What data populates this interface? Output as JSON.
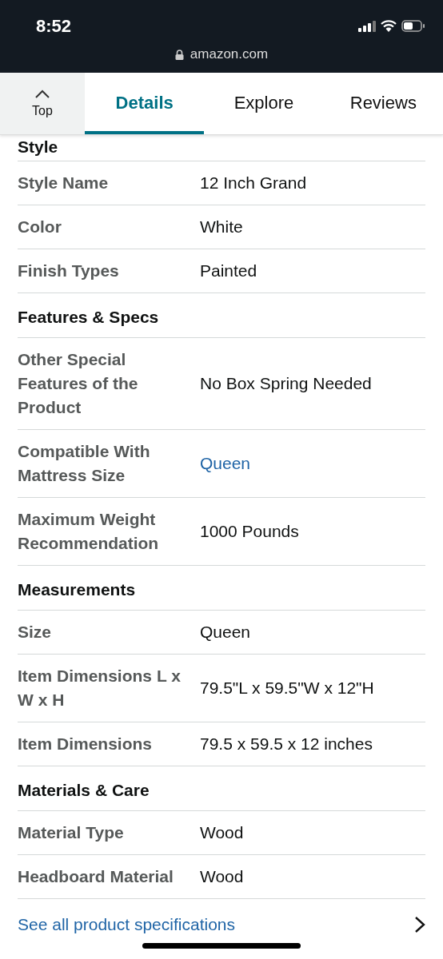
{
  "status_bar": {
    "time": "8:52",
    "url": "amazon.com"
  },
  "tabs": [
    {
      "label": "Top",
      "kind": "top",
      "selected": false
    },
    {
      "label": "Details",
      "kind": "tab",
      "selected": true
    },
    {
      "label": "Explore",
      "kind": "tab",
      "selected": false
    },
    {
      "label": "Reviews",
      "kind": "tab",
      "selected": false
    }
  ],
  "sections": [
    {
      "title": "Style",
      "rows": [
        {
          "label": "Style Name",
          "value": "12 Inch Grand",
          "kind": "text"
        },
        {
          "label": "Color",
          "value": "White",
          "kind": "text"
        },
        {
          "label": "Finish Types",
          "value": "Painted",
          "kind": "text"
        }
      ]
    },
    {
      "title": "Features & Specs",
      "rows": [
        {
          "label": "Other Special Features of the Product",
          "value": "No Box Spring Needed",
          "kind": "text"
        },
        {
          "label": "Compatible With Mattress Size",
          "value": "Queen",
          "kind": "link"
        },
        {
          "label": "Maximum Weight Recommendation",
          "value": "1000 Pounds",
          "kind": "text"
        }
      ]
    },
    {
      "title": "Measurements",
      "rows": [
        {
          "label": "Size",
          "value": "Queen",
          "kind": "text"
        },
        {
          "label": "Item Dimensions L x W x H",
          "value": "79.5\"L x 59.5\"W x 12\"H",
          "kind": "text"
        },
        {
          "label": "Item Dimensions",
          "value": "79.5 x 59.5 x 12 inches",
          "kind": "text"
        }
      ]
    },
    {
      "title": "Materials & Care",
      "rows": [
        {
          "label": "Material Type",
          "value": "Wood",
          "kind": "text"
        },
        {
          "label": "Headboard Material",
          "value": "Wood",
          "kind": "text"
        }
      ]
    }
  ],
  "footer_link": {
    "label": "See all product specifications"
  }
}
